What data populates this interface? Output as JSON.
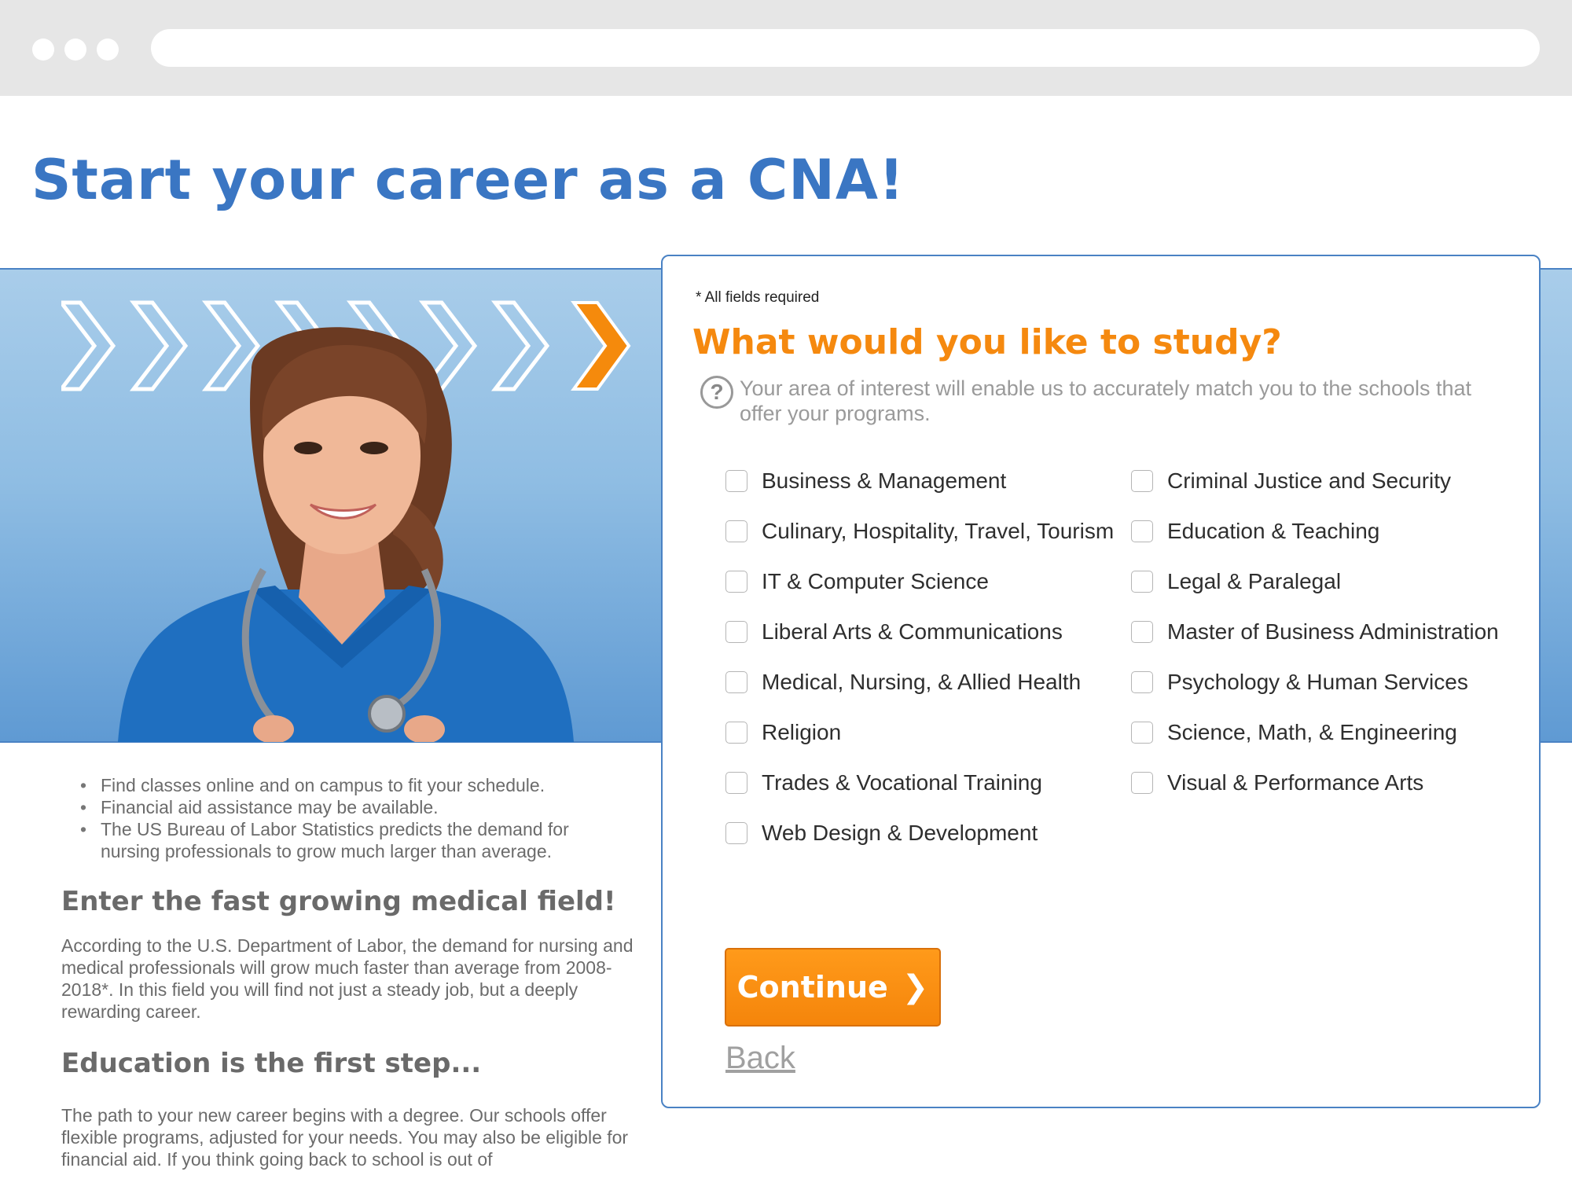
{
  "page": {
    "title": "Start your career as a CNA!"
  },
  "left": {
    "bullets": [
      "Find classes online and on campus to fit your schedule.",
      "Financial aid assistance may be available.",
      "The US Bureau of Labor Statistics predicts the demand for nursing professionals to grow much larger than average."
    ],
    "heading1": "Enter the fast growing medical field!",
    "paragraph1": "According to the U.S. Department of Labor, the demand for nursing and medical professionals will grow much faster than average from 2008-2018*. In this field you will find not just a steady job, but a deeply rewarding career.",
    "heading2": "Education is the first step...",
    "paragraph2": "The path to your new career begins with a degree. Our schools offer flexible programs, adjusted for your needs. You may also be eligible for financial aid. If you think going back to school is out of"
  },
  "form": {
    "required_note": "* All fields required",
    "title": "What would you like to study?",
    "help_icon": "?",
    "help_text": "Your area of interest will enable us to accurately match you to the schools that offer your programs.",
    "options_left": [
      "Business & Management",
      "Culinary, Hospitality, Travel, Tourism",
      "IT & Computer Science",
      "Liberal Arts & Communications",
      "Medical, Nursing, & Allied Health",
      "Religion",
      "Trades & Vocational Training",
      "Web Design & Development"
    ],
    "options_right": [
      "Criminal Justice and Security",
      "Education & Teaching",
      "Legal & Paralegal",
      "Master of Business Administration",
      "Psychology & Human Services",
      "Science, Math, & Engineering",
      "Visual & Performance Arts"
    ],
    "continue_label": "Continue",
    "continue_arrow": "❯",
    "back_label": "Back"
  },
  "colors": {
    "brand_blue": "#3a76c3",
    "accent_orange": "#f5890f",
    "hero_top": "#a9cdea",
    "hero_bottom": "#5f9ad3"
  }
}
